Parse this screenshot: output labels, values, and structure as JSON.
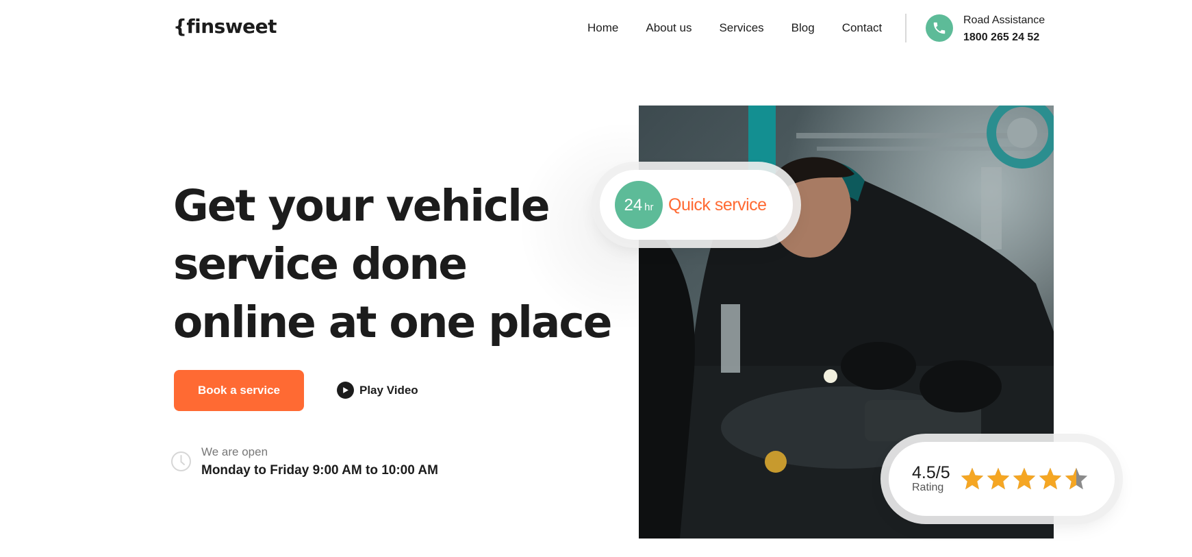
{
  "header": {
    "logo": "{finsweet",
    "nav": [
      "Home",
      "About us",
      "Services",
      "Blog",
      "Contact"
    ],
    "road_assistance_label": "Road Assistance",
    "road_assistance_number": "1800 265 24 52"
  },
  "hero": {
    "title": "Get your vehicle service done online at one place",
    "book_button": "Book a service",
    "play_label": "Play Video",
    "open_label": "We are open",
    "open_hours": "Monday to Friday 9:00 AM to 10:00 AM"
  },
  "badges": {
    "quick_number": "24",
    "quick_unit": "hr",
    "quick_text": "Quick service",
    "rating_value": "4.5/5",
    "rating_label": "Rating",
    "stars": 4.5
  },
  "icons": {
    "phone": "phone-icon",
    "play": "play-icon",
    "clock": "clock-icon",
    "star": "star-icon"
  },
  "colors": {
    "accent_orange": "#ff6a33",
    "accent_green": "#5dbb98",
    "text": "#1c1c1c",
    "star": "#f5a623"
  }
}
